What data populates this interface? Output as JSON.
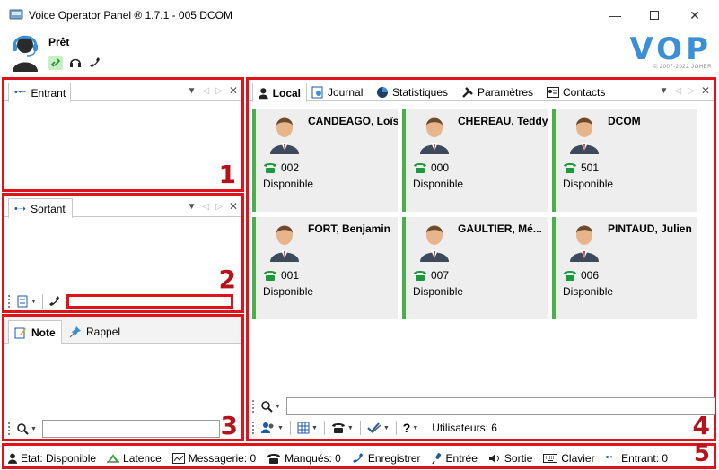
{
  "window": {
    "title": "Voice Operator Panel ® 1.7.1 - 005 DCOM",
    "minimize_icon": "minimize-icon",
    "maximize_icon": "maximize-icon",
    "close_icon": "close-icon"
  },
  "operator": {
    "status": "Prêt",
    "icons": [
      "link-icon",
      "headset-icon",
      "phone-icon"
    ]
  },
  "logo": {
    "text": "VOP",
    "copyright": "© 2007-2022 JOHER"
  },
  "panel_incoming": {
    "tab_label": "Entrant",
    "number": "1"
  },
  "panel_outgoing": {
    "tab_label": "Sortant",
    "number": "2",
    "dial_value": ""
  },
  "panel_notes": {
    "tabs": [
      {
        "label": "Note"
      },
      {
        "label": "Rappel"
      }
    ],
    "number": "3",
    "search_value": ""
  },
  "panel_main": {
    "tabs": [
      {
        "label": "Local"
      },
      {
        "label": "Journal"
      },
      {
        "label": "Statistiques"
      },
      {
        "label": "Paramètres"
      },
      {
        "label": "Contacts"
      }
    ],
    "number": "4",
    "search_value": "",
    "users_count": "Utilisateurs: 6",
    "contacts": [
      {
        "name": "CANDEAGO, Loïs",
        "ext": "002",
        "status": "Disponible"
      },
      {
        "name": "CHEREAU, Teddy",
        "ext": "000",
        "status": "Disponible"
      },
      {
        "name": "DCOM",
        "ext": "501",
        "status": "Disponible"
      },
      {
        "name": "FORT, Benjamin",
        "ext": "001",
        "status": "Disponible"
      },
      {
        "name": "GAULTIER, Mé...",
        "ext": "007",
        "status": "Disponible"
      },
      {
        "name": "PINTAUD, Julien",
        "ext": "006",
        "status": "Disponible"
      }
    ]
  },
  "statusbar": {
    "number": "5",
    "items": [
      {
        "label": "Etat: Disponible"
      },
      {
        "label": "Latence"
      },
      {
        "label": "Messagerie: 0"
      },
      {
        "label": "Manqués: 0"
      },
      {
        "label": "Enregistrer"
      },
      {
        "label": "Entrée"
      },
      {
        "label": "Sortie"
      },
      {
        "label": "Clavier"
      },
      {
        "label": "Entrant: 0"
      }
    ]
  },
  "colors": {
    "highlight_red": "#e0121b",
    "available_green": "#4cae4c",
    "logo_blue": "#3a8fd6"
  }
}
